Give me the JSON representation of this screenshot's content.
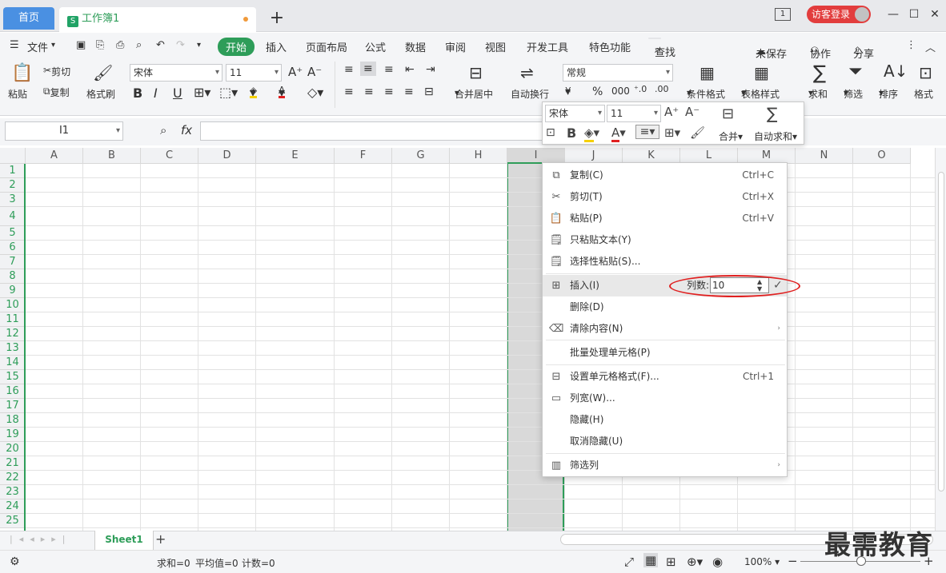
{
  "tabs": {
    "home": "首页",
    "doc": "工作簿1",
    "new": "+"
  },
  "login": "访客登录",
  "menubar": {
    "file": "文件",
    "items": [
      "开始",
      "插入",
      "页面布局",
      "公式",
      "数据",
      "审阅",
      "视图",
      "开发工具",
      "特色功能"
    ],
    "search": "查找",
    "unsaved": "未保存",
    "collab": "协作",
    "share": "分享"
  },
  "ribbon": {
    "paste": "粘贴",
    "cut": "剪切",
    "copy": "复制",
    "format_painter": "格式刷",
    "font": "宋体",
    "size": "11",
    "merge_center": "合并居中",
    "wrap": "自动换行",
    "number_format": "常规",
    "cond_format": "条件格式",
    "table_style": "表格样式",
    "sum": "求和",
    "filter": "筛选",
    "sort": "排序",
    "format": "格式",
    "bold": "B",
    "italic": "I",
    "underline": "U",
    "currency": "¥",
    "percent": "%",
    "thousands": "000"
  },
  "formula": {
    "namebox": "I1",
    "fx": "fx"
  },
  "columns": [
    "A",
    "B",
    "C",
    "D",
    "E",
    "F",
    "G",
    "H",
    "I",
    "J",
    "K",
    "L",
    "M",
    "N",
    "O"
  ],
  "rows": [
    "1",
    "2",
    "3",
    "4",
    "5",
    "6",
    "7",
    "8",
    "9",
    "10",
    "11",
    "12",
    "13",
    "14",
    "15",
    "16",
    "17",
    "18",
    "19",
    "20",
    "21",
    "22",
    "23",
    "24",
    "25"
  ],
  "minitoolbar": {
    "font": "宋体",
    "size": "11",
    "merge": "合并",
    "autosum": "自动求和",
    "bold": "B"
  },
  "context_menu": {
    "copy": {
      "label": "复制(C)",
      "shortcut": "Ctrl+C"
    },
    "cut": {
      "label": "剪切(T)",
      "shortcut": "Ctrl+X"
    },
    "paste": {
      "label": "粘贴(P)",
      "shortcut": "Ctrl+V"
    },
    "paste_text": {
      "label": "只粘贴文本(Y)"
    },
    "paste_special": {
      "label": "选择性粘贴(S)..."
    },
    "insert": {
      "label": "插入(I)",
      "count_label": "列数:",
      "count_value": "10"
    },
    "delete": {
      "label": "删除(D)"
    },
    "clear": {
      "label": "清除内容(N)"
    },
    "batch": {
      "label": "批量处理单元格(P)"
    },
    "format_cells": {
      "label": "设置单元格格式(F)...",
      "shortcut": "Ctrl+1"
    },
    "col_width": {
      "label": "列宽(W)..."
    },
    "hide": {
      "label": "隐藏(H)"
    },
    "unhide": {
      "label": "取消隐藏(U)"
    },
    "filter_col": {
      "label": "筛选列"
    }
  },
  "sheet": {
    "name": "Sheet1"
  },
  "status": {
    "sum": "求和=0",
    "avg": "平均值=0",
    "count": "计数=0",
    "zoom": "100%"
  },
  "watermark": "最需教育",
  "colors": {
    "accent": "#2e9d59",
    "home_tab": "#4a90e2",
    "login": "#e23d3d",
    "highlight_circle": "#e02020"
  }
}
